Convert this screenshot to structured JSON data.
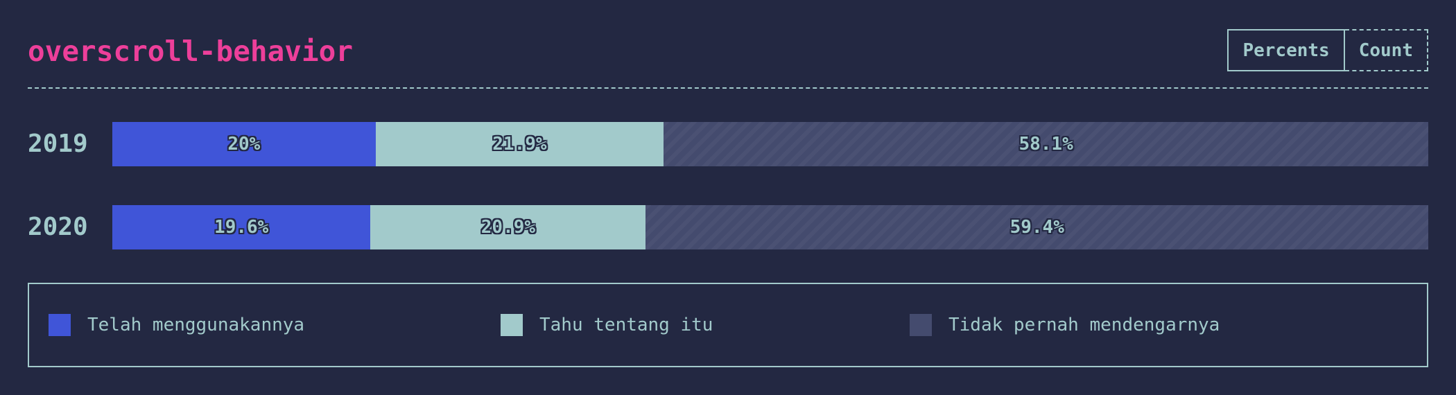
{
  "title": "overscroll-behavior",
  "toggle": {
    "percents_label": "Percents",
    "count_label": "Count"
  },
  "chart_data": {
    "type": "bar",
    "orientation": "horizontal",
    "stacked": true,
    "normalized": true,
    "categories": [
      "2019",
      "2020"
    ],
    "series": [
      {
        "name": "Telah menggunakannya",
        "color": "#4055d8",
        "values": [
          20,
          19.6
        ],
        "labels": [
          "20%",
          "19.6%"
        ]
      },
      {
        "name": "Tahu tentang itu",
        "color": "#a2cacb",
        "values": [
          21.9,
          20.9
        ],
        "labels": [
          "21.9%",
          "20.9%"
        ]
      },
      {
        "name": "Tidak pernah mendengarnya",
        "color": "#444b6e",
        "pattern": "diagonal-stripes",
        "values": [
          58.1,
          59.4
        ],
        "labels": [
          "58.1%",
          "59.4%"
        ]
      }
    ],
    "xlim": [
      0,
      100
    ],
    "legend": "bottom"
  }
}
